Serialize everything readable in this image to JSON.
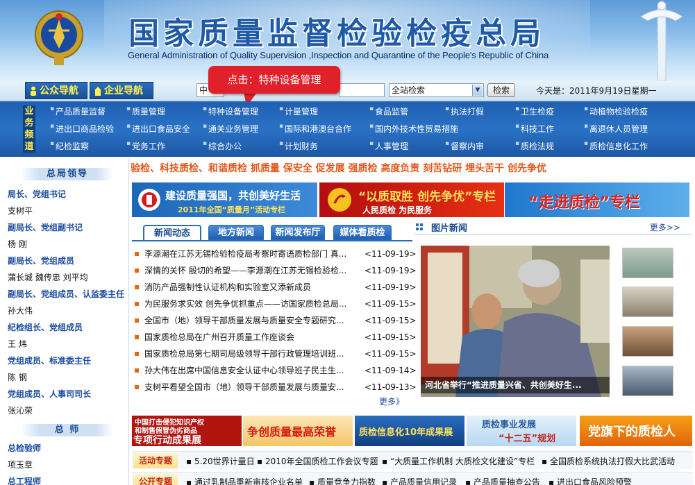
{
  "header": {
    "title_cn": "国家质量监督检验检疫总局",
    "title_en": "General Administration of Quality Supervision ,Inspection and Quarantine of  the People's Republic of China"
  },
  "toolbar": {
    "public_nav": "公众导航",
    "business_nav": "企业导航",
    "left_combo": "中",
    "search_value": "",
    "scope_selected": "全站检索",
    "search_button": "检索",
    "today": "今天是：2011年9月19日星期一"
  },
  "callout": "点击：特种设备管理",
  "menu": {
    "label": "业务频道",
    "rows": [
      [
        "产品质量监督",
        "质量管理",
        "特种设备管理",
        "计量管理",
        "食品监管",
        "执法打假",
        "卫生检疫",
        "动植物检验检疫"
      ],
      [
        "进出口商品检验",
        "进出口食品安全",
        "通关业务管理",
        "国际和港澳台合作",
        "国内外技术性贸易措施",
        "科技工作",
        "离退休人员管理"
      ],
      [
        "纪检监察",
        "党务工作",
        "综合办公",
        "计划财务",
        "人事管理",
        "督察内审",
        "质检法规",
        "质检信息化工作"
      ]
    ]
  },
  "sidebar": {
    "head1": "总局领导",
    "leaders": [
      {
        "title": "局长、党组书记",
        "names": "支树平"
      },
      {
        "title": "副局长、党组副书记",
        "names": "杨 刚"
      },
      {
        "title": "副局长、党组成员",
        "names": "蒲长城  魏传忠  刘平均"
      },
      {
        "title": "副局长、党组成员、认监委主任",
        "names": "孙大伟"
      },
      {
        "title": "纪检组长、党组成员",
        "names": "王 炜"
      },
      {
        "title": "党组成员、标准委主任",
        "names": "陈 钢"
      },
      {
        "title": "党组成员、人事司司长",
        "names": "张沁荣"
      }
    ],
    "head2": "总 师",
    "chiefs": [
      {
        "title": "总检验师",
        "names": "项玉章"
      },
      {
        "title": "总工程师",
        "names": ""
      }
    ]
  },
  "ticker": "验检、科技质检、和谐质检    抓质量  保安全  促发展  强质检  高度负责      刻苦钻研  埋头苦干  创先争优",
  "promos": [
    {
      "line1": "建设质量强国，共创美好生活",
      "line2": "2011年全国“质量月”活动专栏"
    },
    {
      "line1": "“以质取胜  创先争优”专栏",
      "line2": "人民质检  为民服务"
    },
    {
      "line1": "“走进质检”专栏",
      "line2": ""
    }
  ],
  "tabs": [
    "新闻动态",
    "地方新闻",
    "新闻发布厅",
    "媒体看质检"
  ],
  "news": [
    {
      "title": "李源潮在江苏无锡检验检疫局考察时寄语质检部门 真...",
      "date": "<11-09-19>"
    },
    {
      "title": "深情的关怀 殷切的希望——李源潮在江苏无锡检验检...",
      "date": "<11-09-19>"
    },
    {
      "title": "消防产品强制性认证机构和实验室又添新成员",
      "date": "<11-09-19>"
    },
    {
      "title": "为民服务求实效 创先争优抓重点——访国家质检总局...",
      "date": "<11-09-15>"
    },
    {
      "title": "全国市（地）领导干部质量发展与质量安全专题研究...",
      "date": "<11-09-15>"
    },
    {
      "title": "国家质检总局在广州召开质量工作座谈会",
      "date": "<11-09-15>"
    },
    {
      "title": "国家质检总局第七期司局级领导干部行政管理培训班...",
      "date": "<11-09-15>"
    },
    {
      "title": "孙大伟在出席中国信息安全认证中心领导班子民主生...",
      "date": "<11-09-14>"
    },
    {
      "title": "支树平看望全国市（地）领导干部质量发展与质量安...",
      "date": "<11-09-13>"
    }
  ],
  "news_more": "更多》",
  "photo_news": {
    "title": "图片新闻",
    "more": "更多>>",
    "caption": "河北省举行“推进质量兴省、共创美好生..."
  },
  "bottom_banners": [
    {
      "line1": "中国打击侵犯知识产权",
      "line2": "和制售假冒伪劣商品",
      "line3": "专项行动成果展"
    },
    {
      "line1": "争创质量最高荣誉"
    },
    {
      "line1": "质检信息化10年成果展"
    },
    {
      "line1": "质检事业发展",
      "line2": "“十二五”规划"
    },
    {
      "line1": "党旗下的质检人"
    }
  ],
  "ribbons": [
    {
      "tag": "活动专题",
      "items": [
        "5.20世界计量日",
        "2010年全国质检工作会议专题",
        "“大质量工作机制 大质检文化建设”专栏",
        "全国质检系统执法打假大比武活动"
      ]
    },
    {
      "tag": "公开专题",
      "items": [
        "通过乳制品重新审核企业名单",
        "质量竞争力指数",
        "产品质量信用记录",
        "产品质量抽查公告",
        "进出口食品风险预警"
      ]
    }
  ],
  "colors": {
    "menu_blue": "#2a72c6",
    "ticker_orange": "#e2571a",
    "callout_red": "#e0202a",
    "nav_yellow": "#fff44f"
  }
}
